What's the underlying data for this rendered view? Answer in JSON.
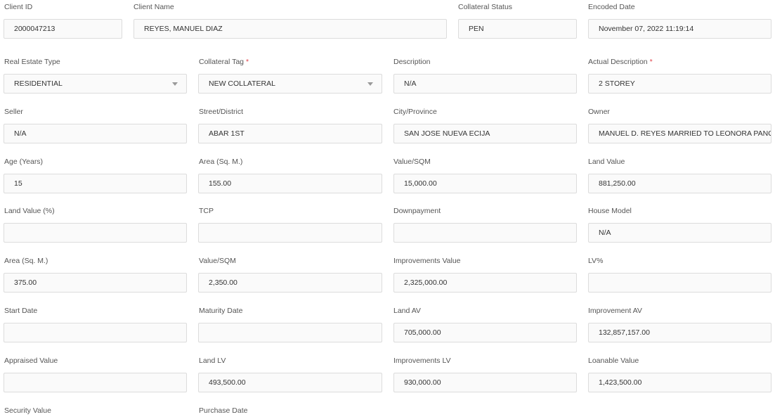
{
  "form": {
    "fields": {
      "client_id": {
        "label": "Client ID",
        "value": "2000047213"
      },
      "client_name": {
        "label": "Client Name",
        "value": "REYES, MANUEL DIAZ"
      },
      "collateral_status": {
        "label": "Collateral Status",
        "value": "PEN"
      },
      "encoded_date": {
        "label": "Encoded Date",
        "value": "November 07, 2022 11:19:14"
      },
      "real_estate_type": {
        "label": "Real Estate Type",
        "value": "RESIDENTIAL"
      },
      "collateral_tag": {
        "label": "Collateral Tag",
        "value": "NEW COLLATERAL"
      },
      "description": {
        "label": "Description",
        "value": "N/A"
      },
      "actual_description": {
        "label": "Actual Description",
        "value": "2 STOREY"
      },
      "seller": {
        "label": "Seller",
        "value": "N/A"
      },
      "street_district": {
        "label": "Street/District",
        "value": "ABAR 1ST"
      },
      "city_province": {
        "label": "City/Province",
        "value": "SAN JOSE NUEVA ECIJA"
      },
      "owner": {
        "label": "Owner",
        "value": "MANUEL D. REYES MARRIED TO LEONORA PANGILINAN"
      },
      "age_years": {
        "label": "Age (Years)",
        "value": "15"
      },
      "area_land": {
        "label": "Area (Sq. M.)",
        "value": "155.00"
      },
      "value_sqm_land": {
        "label": "Value/SQM",
        "value": "15,000.00"
      },
      "land_value": {
        "label": "Land Value",
        "value": "881,250.00"
      },
      "land_value_pct": {
        "label": "Land Value (%)",
        "value": ""
      },
      "tcp": {
        "label": "TCP",
        "value": ""
      },
      "downpayment": {
        "label": "Downpayment",
        "value": ""
      },
      "house_model": {
        "label": "House Model",
        "value": "N/A"
      },
      "area_improvement": {
        "label": "Area (Sq. M.)",
        "value": "375.00"
      },
      "value_sqm_improvement": {
        "label": "Value/SQM",
        "value": "2,350.00"
      },
      "improvements_value": {
        "label": "Improvements Value",
        "value": "2,325,000.00"
      },
      "lv_pct": {
        "label": "LV%",
        "value": ""
      },
      "start_date": {
        "label": "Start Date",
        "value": ""
      },
      "maturity_date": {
        "label": "Maturity Date",
        "value": ""
      },
      "land_av": {
        "label": "Land AV",
        "value": "705,000.00"
      },
      "improvement_av": {
        "label": "Improvement AV",
        "value": "132,857,157.00"
      },
      "appraised_value": {
        "label": "Appraised Value",
        "value": ""
      },
      "land_lv": {
        "label": "Land LV",
        "value": "493,500.00"
      },
      "improvements_lv": {
        "label": "Improvements LV",
        "value": "930,000.00"
      },
      "loanable_value": {
        "label": "Loanable Value",
        "value": "1,423,500.00"
      },
      "security_value": {
        "label": "Security Value"
      },
      "purchase_date": {
        "label": "Purchase Date"
      }
    },
    "required_marker": "*"
  },
  "icons": {
    "dropdown": "chevron-down-icon"
  },
  "colors": {
    "required": "#e0434b",
    "field_border": "#dcdcdc",
    "field_bg": "#fafafa",
    "label_text": "#555555"
  }
}
